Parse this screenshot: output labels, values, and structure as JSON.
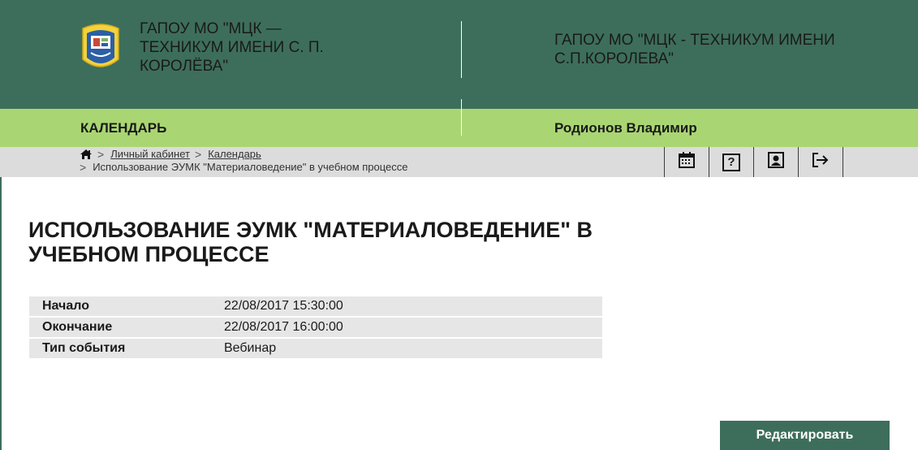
{
  "header": {
    "org_left": "ГАПОУ МО \"МЦК — ТЕХНИКУМ ИМЕНИ С. П. КОРОЛЁВА\"",
    "org_right": "ГАПОУ МО \"МЦК - ТЕХНИКУМ ИМЕНИ С.П.КОРОЛЕВА\""
  },
  "section": {
    "title": "КАЛЕНДАРЬ",
    "user": "Родионов Владимир"
  },
  "breadcrumb": {
    "items": [
      "Личный кабинет",
      "Календарь"
    ],
    "current": "Использование ЭУМК \"Материаловедение\" в учебном процессе"
  },
  "toolbar": {
    "icons": [
      "calendar-icon",
      "help-icon",
      "profile-icon",
      "logout-icon"
    ],
    "help_glyph": "?"
  },
  "event": {
    "title": "ИСПОЛЬЗОВАНИЕ ЭУМК \"МАТЕРИАЛОВЕДЕНИЕ\" В УЧЕБНОМ ПРОЦЕССЕ",
    "rows": [
      {
        "label": "Начало",
        "value": "22/08/2017 15:30:00"
      },
      {
        "label": "Окончание",
        "value": "22/08/2017 16:00:00"
      },
      {
        "label": "Тип события",
        "value": "Вебинар"
      }
    ]
  },
  "actions": {
    "edit_label": "Редактировать"
  },
  "colors": {
    "header_green": "#3d6e5b",
    "section_green": "#a9d672",
    "breadcrumb_gray": "#dcdcdc",
    "row_gray": "#e6e6e6"
  }
}
